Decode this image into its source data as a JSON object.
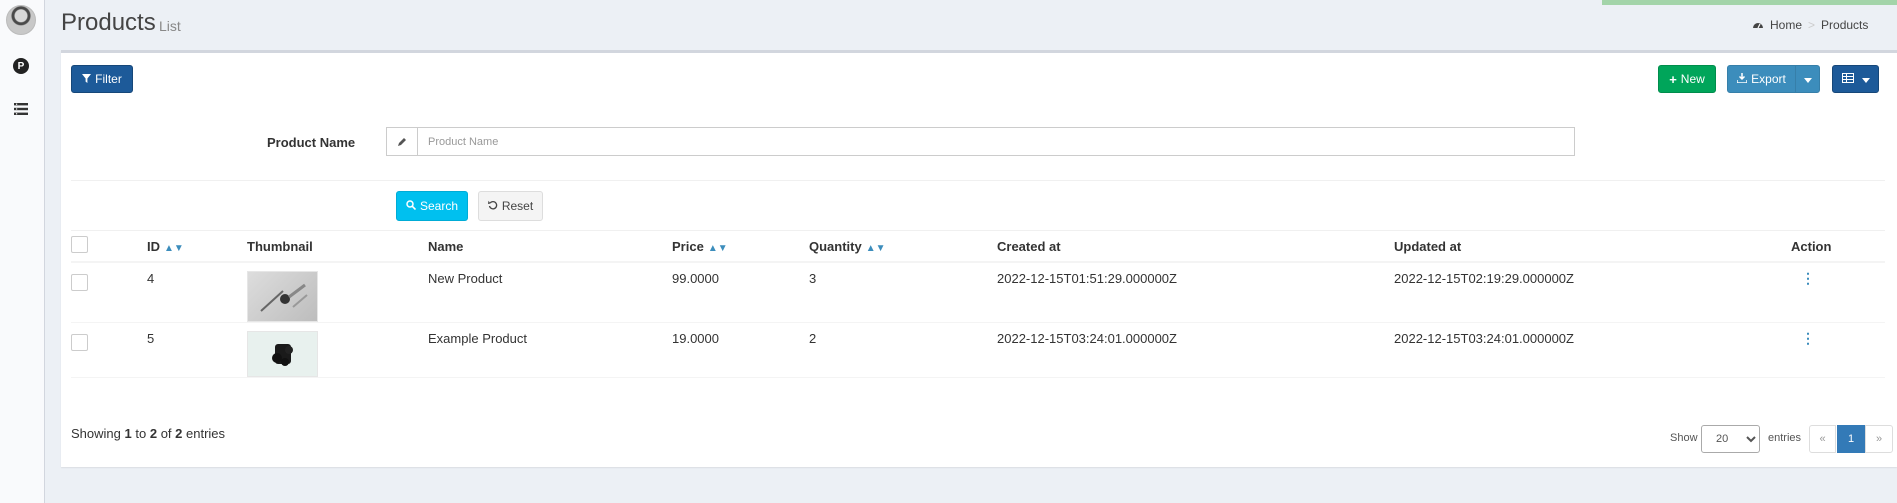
{
  "header": {
    "title": "Products",
    "subtitle": "List",
    "breadcrumb": [
      "Home",
      "Products"
    ]
  },
  "toolbar": {
    "filter_label": "Filter",
    "new_label": "New",
    "export_label": "Export"
  },
  "filter_form": {
    "field_label": "Product Name",
    "field_placeholder": "Product Name",
    "field_value": "",
    "search_label": "Search",
    "reset_label": "Reset"
  },
  "table": {
    "columns": [
      "ID",
      "Thumbnail",
      "Name",
      "Price",
      "Quantity",
      "Created at",
      "Updated at",
      "Action"
    ],
    "sortable_columns": [
      "ID",
      "Price",
      "Quantity"
    ],
    "rows": [
      {
        "id": "4",
        "name": "New Product",
        "price": "99.0000",
        "quantity": "3",
        "created_at": "2022-12-15T01:51:29.000000Z",
        "updated_at": "2022-12-15T02:19:29.000000Z",
        "thumbnail": "metal-tool-image"
      },
      {
        "id": "5",
        "name": "Example Product",
        "price": "19.0000",
        "quantity": "2",
        "created_at": "2022-12-15T03:24:01.000000Z",
        "updated_at": "2022-12-15T03:24:01.000000Z",
        "thumbnail": "black-object-image"
      }
    ]
  },
  "footer": {
    "info_prefix": "Showing",
    "info_from": "1",
    "info_to_word": "to",
    "info_to": "2",
    "info_of_word": "of",
    "info_total": "2",
    "info_suffix": "entries",
    "show_label": "Show",
    "per_page": "20",
    "entries_label": "entries",
    "pager_prev": "«",
    "pager_current": "1",
    "pager_next": "»"
  },
  "colors": {
    "primary": "#3c8dbc",
    "success": "#00a55a",
    "info": "#00c0ef",
    "dark_primary": "#1d5a99"
  },
  "icons": {
    "filter": "filter-icon",
    "new": "plus-icon",
    "export": "download-icon",
    "grid": "table-icon",
    "input": "pencil-icon",
    "search": "search-icon",
    "reset": "undo-icon",
    "breadcrumb_home": "dashboard-icon",
    "action": "kebab-icon"
  }
}
